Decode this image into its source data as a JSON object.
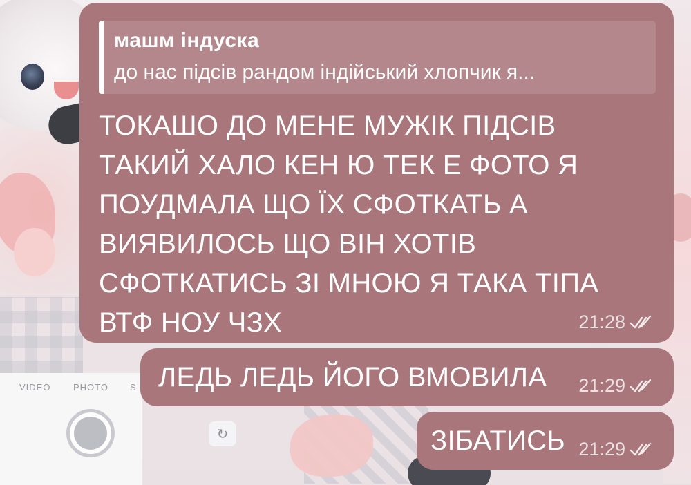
{
  "wallpaper": {
    "camera_modes": [
      "VIDEO",
      "PHOTO",
      "S"
    ]
  },
  "messages": [
    {
      "reply": {
        "author": "машм індуска",
        "snippet": "до нас підсів рандом індійський хлопчик я..."
      },
      "text": "ТОКАШО ДО МЕНЕ МУЖІК ПІДСІВ ТАКИЙ ХАЛО КЕН Ю ТЕК Е ФОТО Я ПОУДМАЛА ЩО ЇХ СФОТКАТЬ А ВИЯВИЛОСЬ ЩО ВІН ХОТІВ СФОТКАТИСЬ ЗІ МНОЮ Я ТАКА ТІПА ВТФ НОУ ЧЗХ",
      "time": "21:28",
      "status_icon": "double-check-icon"
    },
    {
      "text": "ЛЕДЬ ЛЕДЬ ЙОГО ВМОВИЛА",
      "time": "21:29",
      "status_icon": "double-check-icon"
    },
    {
      "text": "ЗІБАТИСЬ",
      "time": "21:29",
      "status_icon": "double-check-icon"
    }
  ],
  "colors": {
    "bubble": "#a9777b",
    "text": "#ffffff"
  }
}
